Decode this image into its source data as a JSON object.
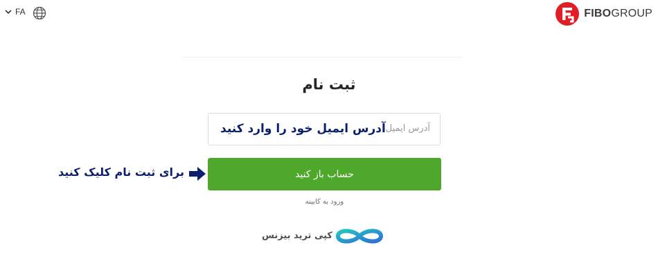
{
  "header": {
    "language": "FA",
    "brand_name_bold": "FIBO",
    "brand_name_light": "GROUP"
  },
  "form": {
    "title": "ثبت نام",
    "email_placeholder": "آدرس ایمیل",
    "open_account_label": "حساب باز کنید",
    "login_link": "ورود به کابینه"
  },
  "annotations": {
    "email_hint": "آدرس ایمیل خود را وارد کنید",
    "click_hint": "برای ثبت نام کلیک کنید"
  },
  "footer": {
    "watermark_text": "کپی ترید بیزنس"
  },
  "colors": {
    "brand_red": "#e01e26",
    "button_green": "#4ea82b",
    "annotation_navy": "#0a1f6e"
  },
  "icons": {
    "language_chevron": "chevron-down-icon",
    "globe": "globe-icon",
    "arrow": "arrow-right-icon"
  }
}
